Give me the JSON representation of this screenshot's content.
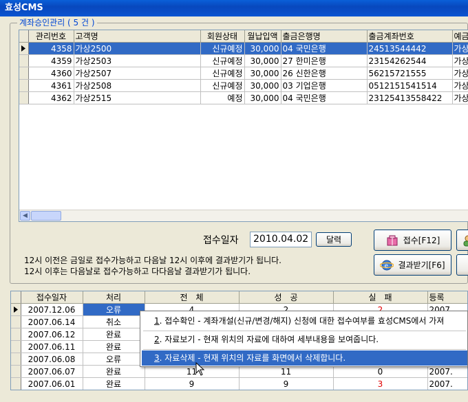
{
  "window": {
    "title": "효성CMS"
  },
  "account_group": {
    "legend": "계좌승인관리 ( 5 건 )"
  },
  "account_table": {
    "headers": [
      "관리번호",
      "고객명",
      "회원상태",
      "월납입액",
      "출금은행명",
      "출금계좌번호",
      "예금"
    ],
    "rows": [
      [
        "4358",
        "가상2500",
        "신규예정",
        "30,000",
        "04 국민은행",
        "24513544442",
        "가상"
      ],
      [
        "4359",
        "가상2503",
        "신규예정",
        "30,000",
        "27 한미은행",
        "23154262544",
        "가상"
      ],
      [
        "4360",
        "가상2507",
        "신규예정",
        "30,000",
        "26 신한은행",
        "56215721555",
        "가상"
      ],
      [
        "4361",
        "가상2508",
        "신규예정",
        "30,000",
        "03 기업은행",
        "0512151541514",
        "가상"
      ],
      [
        "4362",
        "가상2515",
        "예정",
        "30,000",
        "04 국민은행",
        "23125413558422",
        "가상"
      ]
    ]
  },
  "receipt": {
    "date_label": "접수일자",
    "date_value": "2010.04.02",
    "calendar_button": "달력",
    "submit_button": "접수[F12]",
    "result_button": "결과받기[F6]",
    "info_line1": "12시 이전은 금일로 접수가능하고 다음날 12시 이후에 결과받기가 됩니다.",
    "info_line2": "12시 이후는 다음날로 접수가능하고 다다음날 결과받기가 됩니다."
  },
  "history_table": {
    "headers": [
      "접수일자",
      "처리",
      "전　체",
      "성　공",
      "실　패",
      "등록"
    ],
    "rows": [
      [
        "2007.12.06",
        "오류",
        "4",
        "2",
        "2",
        "2007."
      ],
      [
        "2007.06.14",
        "취소",
        "",
        "",
        "",
        ""
      ],
      [
        "2007.06.12",
        "완료",
        "",
        "",
        "",
        ""
      ],
      [
        "2007.06.11",
        "완료",
        "",
        "",
        "",
        ""
      ],
      [
        "2007.06.08",
        "오류",
        "",
        "",
        "",
        ""
      ],
      [
        "2007.06.07",
        "완료",
        "11",
        "11",
        "0",
        "2007."
      ],
      [
        "2007.06.01",
        "완료",
        "9",
        "9",
        "3",
        "2007."
      ]
    ]
  },
  "context_menu": {
    "items": [
      {
        "key": "1",
        "text": ". 접수확인 - 계좌개설(신규/변경/해지) 신청에 대한 접수여부를 효성CMS에서 가져"
      },
      {
        "key": "2",
        "text": ". 자료보기 - 현재 위치의 자료에 대하여 세부내용을 보여줍니다."
      },
      {
        "key": "3",
        "text": ". 자료삭제 - 현재 위치의 자료를 화면에서 삭제합니다."
      }
    ]
  },
  "colors": {
    "selection": "#316AC5",
    "legend": "#0046D5",
    "fail_value": "#E00000"
  }
}
